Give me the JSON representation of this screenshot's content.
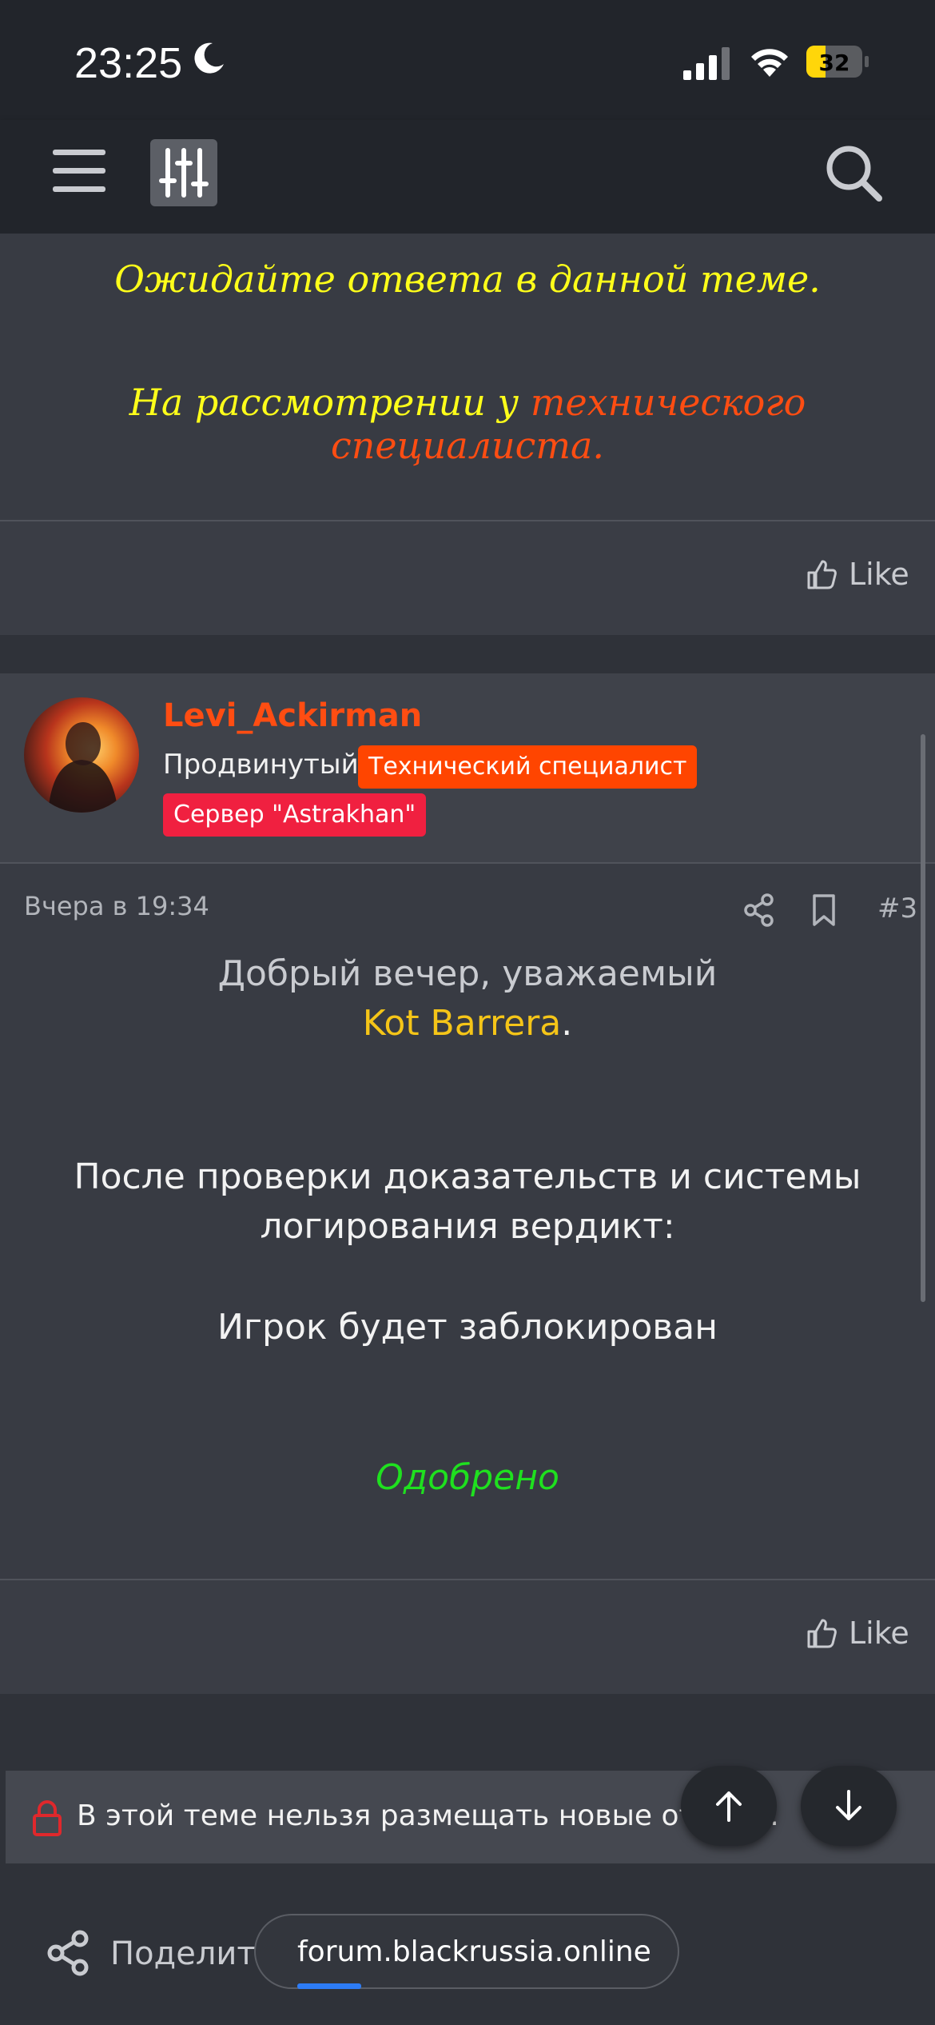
{
  "status_bar": {
    "time": "23:25",
    "battery": "32",
    "icons": [
      "moon-icon",
      "cellular-signal-icon",
      "wifi-icon",
      "battery-icon"
    ]
  },
  "nav": {
    "icons": [
      "hamburger-menu-icon",
      "filter-sliders-icon",
      "search-icon"
    ]
  },
  "post_prev": {
    "line1": "Ожидайте ответа в данной теме.",
    "line2_prefix": "На рассмотрении у ",
    "line2_highlight": "технического специалиста.",
    "like_label": "Like"
  },
  "post": {
    "author": "Levi_Ackirman",
    "rank": "Продвинутый",
    "badges": [
      "Технический специалист",
      "Сервер \"Astrakhan\""
    ],
    "date": "Вчера в 19:34",
    "number": "#3",
    "greeting_line1": "Добрый вечер, уважаемый",
    "greeting_name": "Kot Barrera",
    "greeting_end": ".",
    "body_line1": "После проверки доказательств и системы",
    "body_line2": "логирования вердикт:",
    "verdict": "Игрок будет заблокирован",
    "status": "Одобрено",
    "like_label": "Like"
  },
  "notice": {
    "text": "В этой теме нельзя размещать новые ответы."
  },
  "bottom": {
    "share_label": "Поделиться",
    "url": "forum.blackrussia.online",
    "progress": 0.16
  },
  "colors": {
    "accent_orange": "#ff4d12",
    "highlight_yellow": "#ffff1a",
    "approved_green": "#1fe01f",
    "badge_tech": "#ff4500",
    "badge_server": "#f02040"
  }
}
